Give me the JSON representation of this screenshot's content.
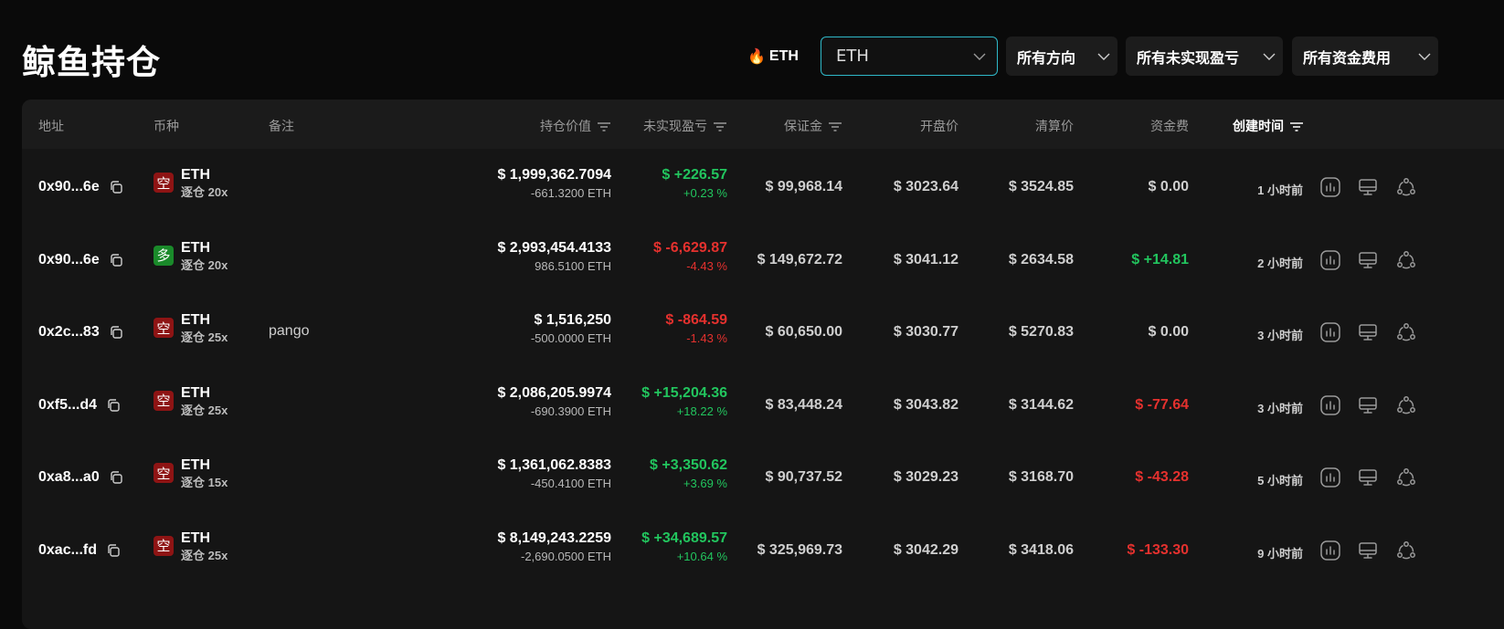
{
  "page": {
    "title": "鲸鱼持仓"
  },
  "filters": {
    "hot_label": "ETH",
    "coin_select": {
      "value": "ETH"
    },
    "direction": {
      "label": "所有方向"
    },
    "pnl": {
      "label": "所有未实现盈亏"
    },
    "funding": {
      "label": "所有资金费用"
    }
  },
  "columns": {
    "address": "地址",
    "coin": "币种",
    "note": "备注",
    "value": "持仓价值",
    "pnl": "未实现盈亏",
    "margin": "保证金",
    "entry": "开盘价",
    "liq": "清算价",
    "funding": "资金费",
    "created": "创建时间"
  },
  "rows": [
    {
      "address": "0x90...6e",
      "side": "空",
      "side_type": "short",
      "coin": "ETH",
      "mode": "逐仓 20x",
      "note": "",
      "value": "$ 1,999,362.7094",
      "size": "-661.3200 ETH",
      "pnl": "$ +226.57",
      "pnl_pct": "+0.23 %",
      "pnl_sign": "pos",
      "margin": "$ 99,968.14",
      "entry": "$ 3023.64",
      "liq": "$ 3524.85",
      "funding": "$ 0.00",
      "funding_sign": "neutral",
      "created": "1 小时前"
    },
    {
      "address": "0x90...6e",
      "side": "多",
      "side_type": "long",
      "coin": "ETH",
      "mode": "逐仓 20x",
      "note": "",
      "value": "$ 2,993,454.4133",
      "size": "986.5100 ETH",
      "pnl": "$ -6,629.87",
      "pnl_pct": "-4.43 %",
      "pnl_sign": "neg",
      "margin": "$ 149,672.72",
      "entry": "$ 3041.12",
      "liq": "$ 2634.58",
      "funding": "$ +14.81",
      "funding_sign": "pos",
      "created": "2 小时前"
    },
    {
      "address": "0x2c...83",
      "side": "空",
      "side_type": "short",
      "coin": "ETH",
      "mode": "逐仓 25x",
      "note": "pango",
      "value": "$ 1,516,250",
      "size": "-500.0000 ETH",
      "pnl": "$ -864.59",
      "pnl_pct": "-1.43 %",
      "pnl_sign": "neg",
      "margin": "$ 60,650.00",
      "entry": "$ 3030.77",
      "liq": "$ 5270.83",
      "funding": "$ 0.00",
      "funding_sign": "neutral",
      "created": "3 小时前"
    },
    {
      "address": "0xf5...d4",
      "side": "空",
      "side_type": "short",
      "coin": "ETH",
      "mode": "逐仓 25x",
      "note": "",
      "value": "$ 2,086,205.9974",
      "size": "-690.3900 ETH",
      "pnl": "$ +15,204.36",
      "pnl_pct": "+18.22 %",
      "pnl_sign": "pos",
      "margin": "$ 83,448.24",
      "entry": "$ 3043.82",
      "liq": "$ 3144.62",
      "funding": "$ -77.64",
      "funding_sign": "neg",
      "created": "3 小时前"
    },
    {
      "address": "0xa8...a0",
      "side": "空",
      "side_type": "short",
      "coin": "ETH",
      "mode": "逐仓 15x",
      "note": "",
      "value": "$ 1,361,062.8383",
      "size": "-450.4100 ETH",
      "pnl": "$ +3,350.62",
      "pnl_pct": "+3.69 %",
      "pnl_sign": "pos",
      "margin": "$ 90,737.52",
      "entry": "$ 3029.23",
      "liq": "$ 3168.70",
      "funding": "$ -43.28",
      "funding_sign": "neg",
      "created": "5 小时前"
    },
    {
      "address": "0xac...fd",
      "side": "空",
      "side_type": "short",
      "coin": "ETH",
      "mode": "逐仓 25x",
      "note": "",
      "value": "$ 8,149,243.2259",
      "size": "-2,690.0500 ETH",
      "pnl": "$ +34,689.57",
      "pnl_pct": "+10.64 %",
      "pnl_sign": "pos",
      "margin": "$ 325,969.73",
      "entry": "$ 3042.29",
      "liq": "$ 3418.06",
      "funding": "$ -133.30",
      "funding_sign": "neg",
      "created": "9 小时前"
    }
  ],
  "icons": {
    "copy": "copy-icon",
    "filter": "filter-icon",
    "chart": "chart-icon",
    "monitor": "monitor-icon",
    "share": "share-icon",
    "flame": "flame-icon",
    "chevron": "chevron-down-icon"
  },
  "colors": {
    "accent": "#2fb8c8",
    "positive": "#22c55e",
    "negative": "#e5312e",
    "short_badge": "#8e1414",
    "long_badge": "#1a8a2a"
  }
}
